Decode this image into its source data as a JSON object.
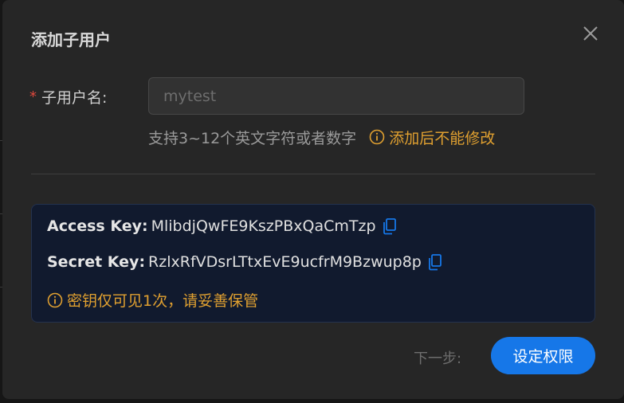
{
  "dialog": {
    "title": "添加子用户",
    "close_icon": "close-icon"
  },
  "form": {
    "required_mark": "*",
    "username_label": "子用户名:",
    "username_value": "mytest",
    "hint": "支持3~12个英文字符或者数字",
    "warning": "添加后不能修改",
    "warning_color": "#e0a030"
  },
  "keys": {
    "access_label": "Access Key:",
    "access_value": "MlibdjQwFE9KszPBxQaCmTzp",
    "secret_label": "Secret Key:",
    "secret_value": "RzlxRfVDsrLTtxEvE9ucfrM9Bzwup8p",
    "copy_icon": "copy-icon",
    "notice": "密钥仅可见1次，请妥善保管"
  },
  "footer": {
    "next_step_label": "下一步:",
    "primary_button": "设定权限",
    "primary_color": "#1677e8"
  }
}
